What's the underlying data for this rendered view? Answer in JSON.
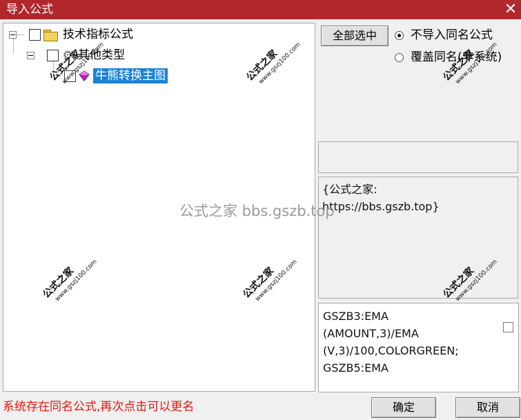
{
  "window": {
    "title": "导入公式",
    "close_glyph": "✕"
  },
  "tree": {
    "root_label": "技术指标公式",
    "group_label": "其他类型",
    "item_label": "牛熊转换主图"
  },
  "buttons": {
    "select_all": "全部选中",
    "ok": "确定",
    "cancel": "取消"
  },
  "options": {
    "skip_same_name": "不导入同名公式",
    "overwrite_same_name": "覆盖同名(非系统)",
    "selected": "skip_same_name"
  },
  "description": "{公式之家:\nhttps://bbs.gszb.top}",
  "code": "GSZB3:EMA\n(AMOUNT,3)/EMA\n(V,3)/100,COLORGREEN;\nGSZB5:EMA",
  "status": "系统存在同名公式,再次点击可以更名",
  "watermarks": {
    "main": "公式之家",
    "site": "www.gszj100.com",
    "center": "公式之家 bbs.gszb.top"
  },
  "colors": {
    "titlebar": "#b1282c",
    "selection": "#1a82d8",
    "status_text": "#e8150c"
  }
}
